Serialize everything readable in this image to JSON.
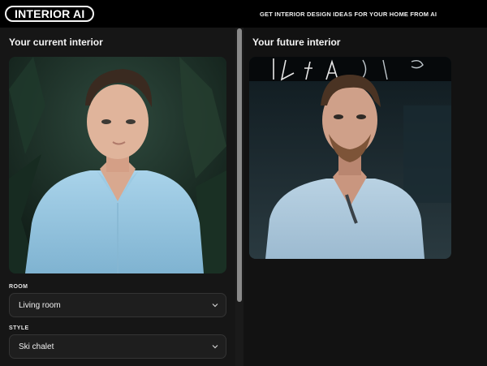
{
  "header": {
    "logo_text": "INTERIOR AI",
    "tagline": "GET INTERIOR DESIGN IDEAS FOR YOUR HOME FROM AI"
  },
  "left": {
    "title": "Your current interior",
    "room_label": "ROOM",
    "room_value": "Living room",
    "style_label": "STYLE",
    "style_value": "Ski chalet"
  },
  "right": {
    "title": "Your future interior"
  },
  "colors": {
    "background": "#101010",
    "topbar": "#000000",
    "select_bg": "#1e1e1e",
    "text": "#f2f2f2"
  },
  "icons": {
    "select_chevron": "chevron-down-icon"
  }
}
